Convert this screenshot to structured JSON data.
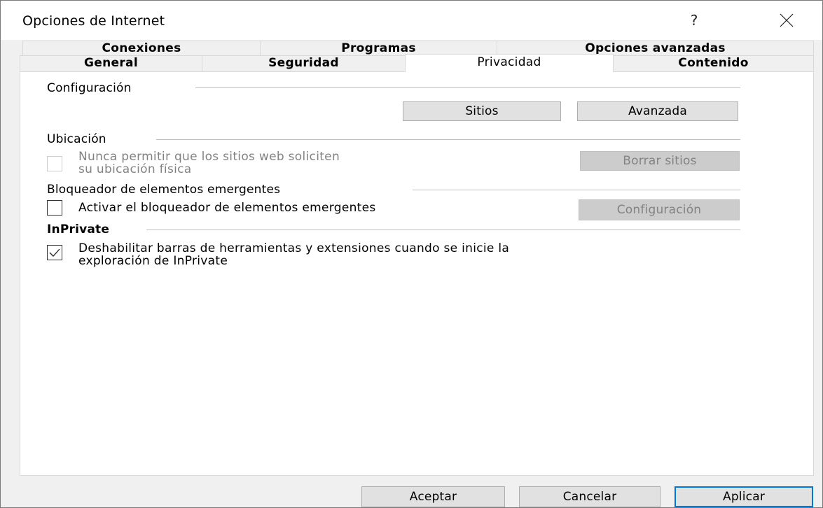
{
  "window": {
    "title": "Opciones de Internet",
    "help_label": "?"
  },
  "tabs": {
    "row1": [
      {
        "label": "Conexiones"
      },
      {
        "label": "Programas"
      },
      {
        "label": "Opciones avanzadas"
      }
    ],
    "row2": [
      {
        "label": "General"
      },
      {
        "label": "Seguridad"
      },
      {
        "label": "Privacidad",
        "selected": true
      },
      {
        "label": "Contenido"
      }
    ]
  },
  "privacy": {
    "configuracion": {
      "group_label": "Configuración",
      "sites_button": "Sitios",
      "advanced_button": "Avanzada"
    },
    "ubicacion": {
      "group_label": "Ubicación",
      "checkbox_label_line1": "Nunca permitir que los sitios web soliciten",
      "checkbox_label_line2": "su ubicación física",
      "checkbox_checked": false,
      "checkbox_enabled": false,
      "clear_sites_button": "Borrar sitios"
    },
    "popup_blocker": {
      "group_label": "Bloqueador de elementos emergentes",
      "checkbox_label": "Activar el bloqueador de elementos emergentes",
      "checkbox_checked": false,
      "settings_button": "Configuración"
    },
    "inprivate": {
      "group_label": "InPrivate",
      "checkbox_label_line1": "Deshabilitar barras de herramientas y extensiones cuando se inicie la",
      "checkbox_label_line2": "exploración de InPrivate",
      "checkbox_checked": true
    }
  },
  "footer": {
    "ok_button": "Aceptar",
    "cancel_button": "Cancelar",
    "apply_button": "Aplicar"
  },
  "colors": {
    "accent": "#0078d7",
    "dialog_bg": "#f0f0f0",
    "panel_bg": "#ffffff",
    "disabled_text": "#838383"
  }
}
